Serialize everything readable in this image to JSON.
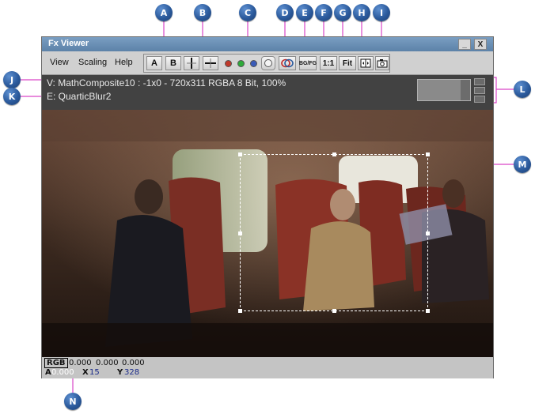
{
  "window": {
    "title": "Fx Viewer",
    "minimize_label": "_",
    "close_label": "X"
  },
  "menu": {
    "items": [
      "View",
      "Scaling",
      "Help"
    ]
  },
  "toolbar": {
    "a_label": "A",
    "b_label": "B",
    "bg_fg_label": "BG/FG",
    "one_to_one_label": "1:1",
    "fit_label": "Fit",
    "channel_colors": [
      "#c0392b",
      "#2eaa3a",
      "#3a5bb8",
      "#f4f4f4"
    ]
  },
  "info": {
    "line1": "V: MathComposite10 : -1x0 - 720x311 RGBA 8 Bit, 100%",
    "line2": "E: QuarticBlur2"
  },
  "status": {
    "mode": "RGB",
    "r": "0.000",
    "g": "0.000",
    "b": "0.000",
    "a_label": "A",
    "a_value": "0.000",
    "x_label": "X",
    "x_value": "15",
    "y_label": "Y",
    "y_value": "328"
  },
  "callouts": [
    "A",
    "B",
    "C",
    "D",
    "E",
    "F",
    "G",
    "H",
    "I",
    "J",
    "K",
    "L",
    "M",
    "N"
  ],
  "colors": {
    "callout": "#2b5a9c",
    "leader_line": "#d946c8",
    "infobar": "#424242"
  }
}
